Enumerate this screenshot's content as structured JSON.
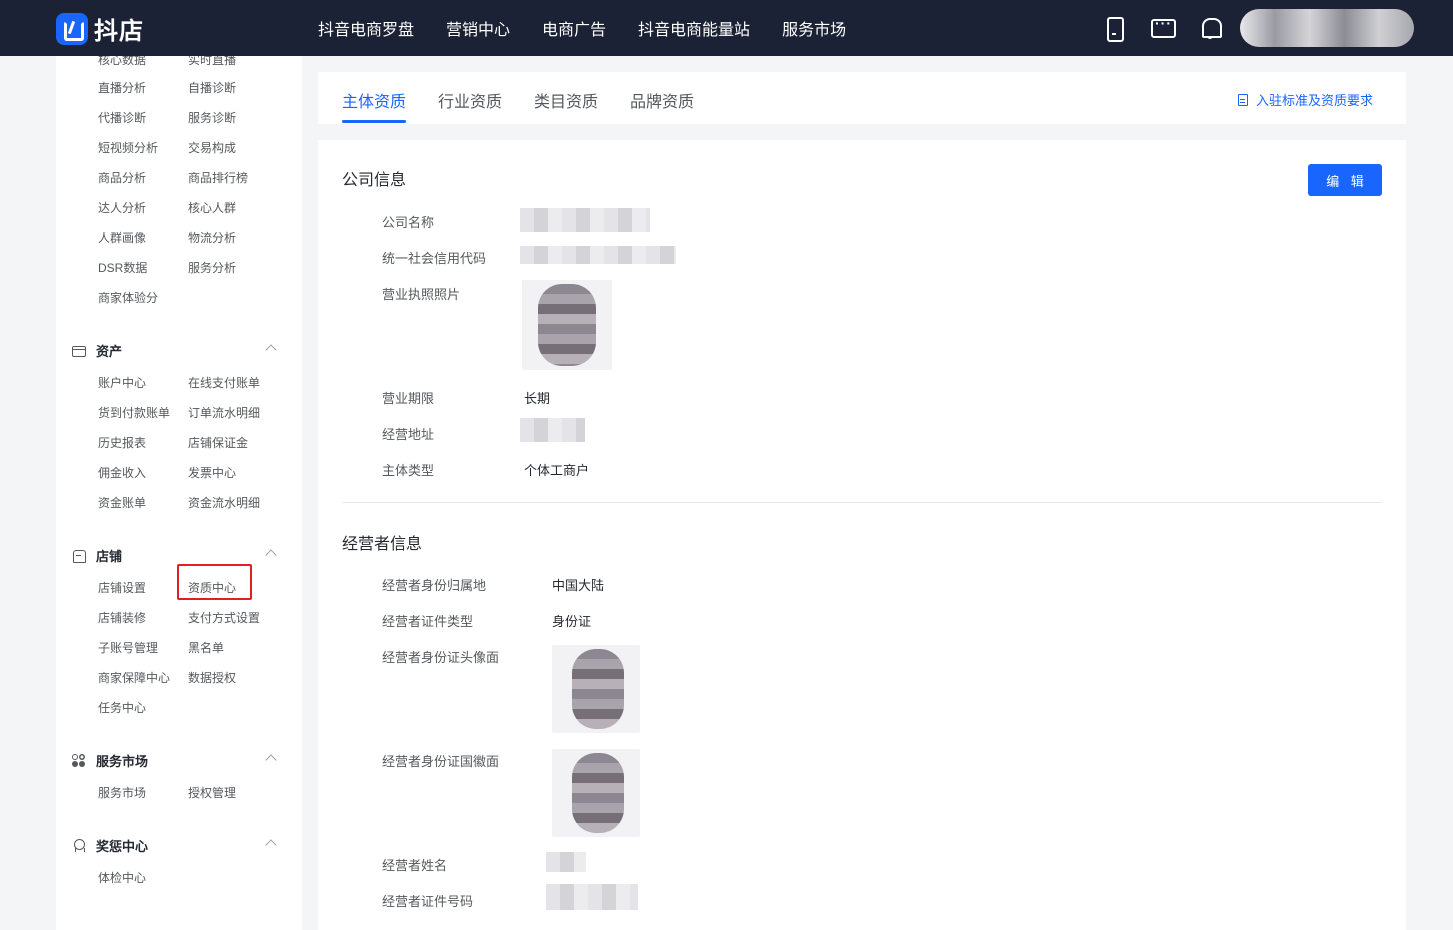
{
  "app": {
    "logo_text": "抖店"
  },
  "topnav": [
    "抖音电商罗盘",
    "营销中心",
    "电商广告",
    "抖音电商能量站",
    "服务市场"
  ],
  "sidebar": {
    "partial_top": [
      "核心数据",
      "实时直播"
    ],
    "data_items": [
      "直播分析",
      "自播诊断",
      "代播诊断",
      "服务诊断",
      "短视频分析",
      "交易构成",
      "商品分析",
      "商品排行榜",
      "达人分析",
      "核心人群",
      "人群画像",
      "物流分析",
      "DSR数据",
      "服务分析",
      "商家体验分"
    ],
    "groups": [
      {
        "title": "资产",
        "items": [
          "账户中心",
          "在线支付账单",
          "货到付款账单",
          "订单流水明细",
          "历史报表",
          "店铺保证金",
          "佣金收入",
          "发票中心",
          "资金账单",
          "资金流水明细"
        ]
      },
      {
        "title": "店铺",
        "items": [
          "店铺设置",
          "资质中心",
          "店铺装修",
          "支付方式设置",
          "子账号管理",
          "黑名单",
          "商家保障中心",
          "数据授权",
          "任务中心"
        ]
      },
      {
        "title": "服务市场",
        "items": [
          "服务市场",
          "授权管理"
        ]
      },
      {
        "title": "奖惩中心",
        "items": [
          "体检中心"
        ]
      }
    ]
  },
  "tabs": [
    "主体资质",
    "行业资质",
    "类目资质",
    "品牌资质"
  ],
  "requirements_link": "入驻标准及资质要求",
  "company": {
    "title": "公司信息",
    "edit_label": "编 辑",
    "labels": [
      "公司名称",
      "统一社会信用代码",
      "营业执照照片",
      "营业期限",
      "经营地址",
      "主体类型"
    ],
    "term": "长期",
    "entity_type": "个体工商户"
  },
  "operator": {
    "title": "经营者信息",
    "labels": [
      "经营者身份归属地",
      "经营者证件类型",
      "经营者身份证头像面",
      "经营者身份证国徽面",
      "经营者姓名",
      "经营者证件号码"
    ],
    "region": "中国大陆",
    "id_type": "身份证"
  }
}
